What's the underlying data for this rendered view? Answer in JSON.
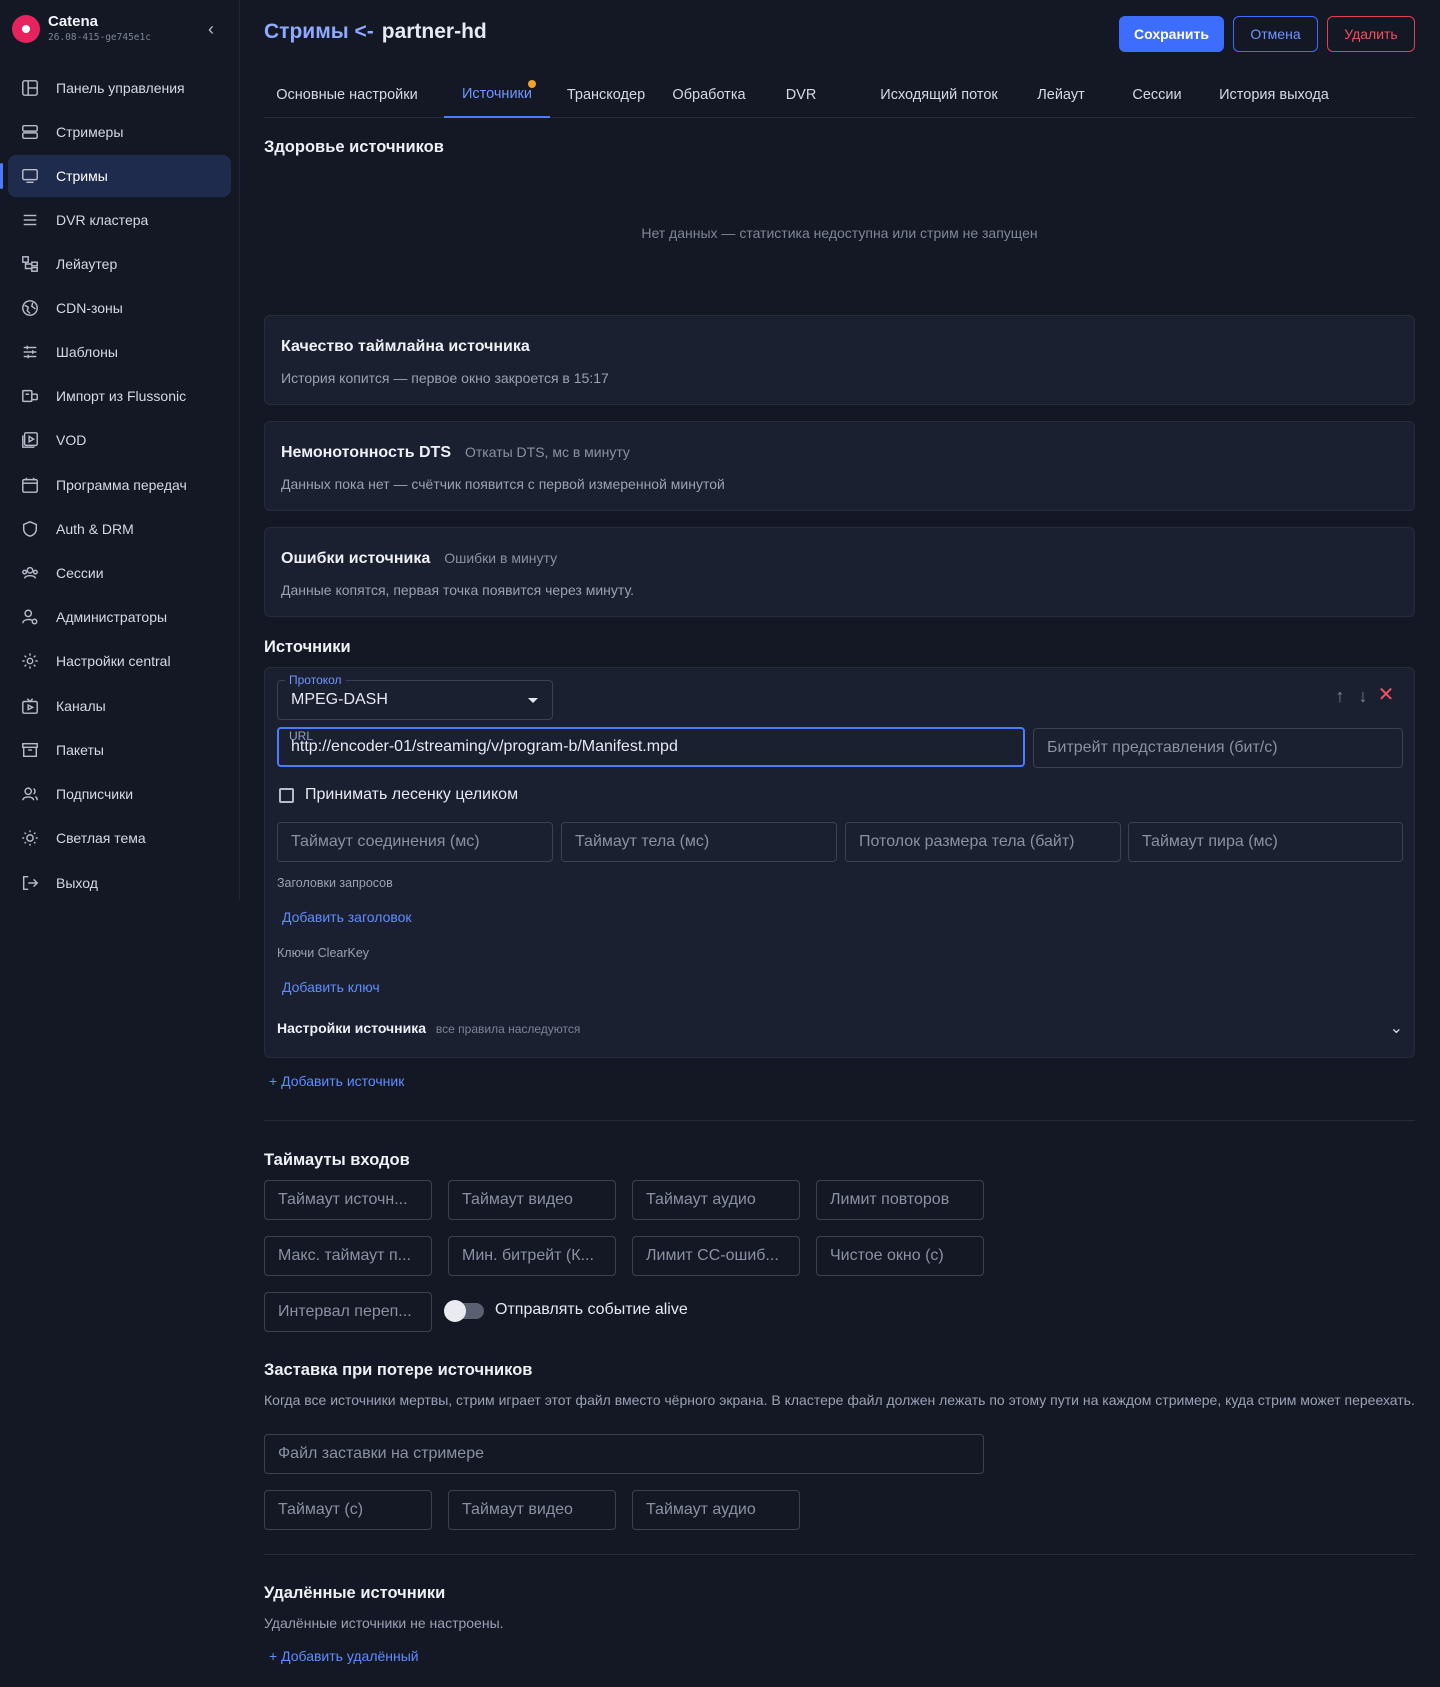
{
  "brand": {
    "name": "Catena",
    "version": "26.08-415-ge745e1c"
  },
  "sidebar": {
    "items": [
      {
        "label": "Панель управления",
        "icon": "dashboard-icon"
      },
      {
        "label": "Стримеры",
        "icon": "server-icon"
      },
      {
        "label": "Стримы",
        "icon": "monitor-icon",
        "active": true
      },
      {
        "label": "DVR кластера",
        "icon": "database-icon"
      },
      {
        "label": "Лейаутер",
        "icon": "layout-icon"
      },
      {
        "label": "CDN-зоны",
        "icon": "globe-icon"
      },
      {
        "label": "Шаблоны",
        "icon": "sliders-icon"
      },
      {
        "label": "Импорт из Flussonic",
        "icon": "import-icon"
      },
      {
        "label": "VOD",
        "icon": "video-library-icon"
      },
      {
        "label": "Программа передач",
        "icon": "calendar-icon"
      },
      {
        "label": "Auth & DRM",
        "icon": "shield-icon"
      },
      {
        "label": "Сессии",
        "icon": "users-icon"
      },
      {
        "label": "Администраторы",
        "icon": "admin-icon"
      },
      {
        "label": "Настройки central",
        "icon": "gear-icon"
      },
      {
        "label": "Каналы",
        "icon": "tv-icon"
      },
      {
        "label": "Пакеты",
        "icon": "archive-icon"
      },
      {
        "label": "Подписчики",
        "icon": "subscribers-icon"
      },
      {
        "label": "Светлая тема",
        "icon": "sun-icon"
      },
      {
        "label": "Выход",
        "icon": "logout-icon"
      }
    ]
  },
  "header": {
    "crumb": "Стримы <-",
    "stream_name": "partner-hd",
    "save": "Сохранить",
    "cancel": "Отмена",
    "delete": "Удалить"
  },
  "tabs": [
    {
      "label": "Основные настройки"
    },
    {
      "label": "Источники",
      "active": true,
      "has_dot": true
    },
    {
      "label": "Транскодер"
    },
    {
      "label": "Обработка"
    },
    {
      "label": "DVR"
    },
    {
      "label": "Исходящий поток"
    },
    {
      "label": "Лейаут"
    },
    {
      "label": "Сессии"
    },
    {
      "label": "История выхода"
    }
  ],
  "health": {
    "title": "Здоровье источников",
    "empty": "Нет данных — статистика недоступна или стрим не запущен"
  },
  "cards": {
    "timeline": {
      "title": "Качество таймлайна источника",
      "text": "История копится — первое окно закроется в 15:17"
    },
    "dts": {
      "title": "Немонотонность DTS",
      "sub": "Откаты DTS, мс в минуту",
      "text": "Данных пока нет — счётчик появится с первой измеренной минутой"
    },
    "errors": {
      "title": "Ошибки источника",
      "sub": "Ошибки в минуту",
      "text": "Данные копятся, первая точка появится через минуту."
    }
  },
  "sources": {
    "title": "Источники",
    "protocol_label": "Протокол",
    "protocol_value": "MPEG-DASH",
    "url_label": "URL",
    "url_value": "http://encoder-01/streaming/v/program-b/Manifest.mpd",
    "bitrate_placeholder": "Битрейт представления (бит/с)",
    "accept_ladder": "Принимать лесенку целиком",
    "connect_timeout": "Таймаут соединения (мс)",
    "body_timeout": "Таймаут тела (мс)",
    "body_size_limit": "Потолок размера тела (байт)",
    "peer_timeout": "Таймаут пира (мс)",
    "headers_label": "Заголовки запросов",
    "add_header": "Добавить заголовок",
    "clearkey_label": "Ключи ClearKey",
    "add_key": "Добавить ключ",
    "settings_title": "Настройки источника",
    "settings_note": "все правила наследуются",
    "add_source": "+ Добавить источник"
  },
  "timeouts": {
    "title": "Таймауты входов",
    "fields": [
      "Таймаут источн...",
      "Таймаут видео",
      "Таймаут аудио",
      "Лимит повторов",
      "Макс. таймаут п...",
      "Мин. битрейт (К...",
      "Лимит CC-ошиб...",
      "Чистое окно (с)",
      "Интервал переп..."
    ],
    "alive_label": "Отправлять событие alive"
  },
  "fallback": {
    "title": "Заставка при потере источников",
    "description": "Когда все источники мертвы, стрим играет этот файл вместо чёрного экрана. В кластере файл должен лежать по этому пути на каждом стримере, куда стрим может переехать.",
    "file_placeholder": "Файл заставки на стримере",
    "timeout": "Таймаут (с)",
    "video_timeout": "Таймаут видео",
    "audio_timeout": "Таймаут аудио"
  },
  "remote": {
    "title": "Удалённые источники",
    "empty": "Удалённые источники не настроены.",
    "add": "+ Добавить удалённый"
  },
  "colors": {
    "accent": "#3d6dff",
    "danger": "#f05261",
    "background": "#141825",
    "card": "#1b2030",
    "tab_dot": "#f0a32b"
  }
}
